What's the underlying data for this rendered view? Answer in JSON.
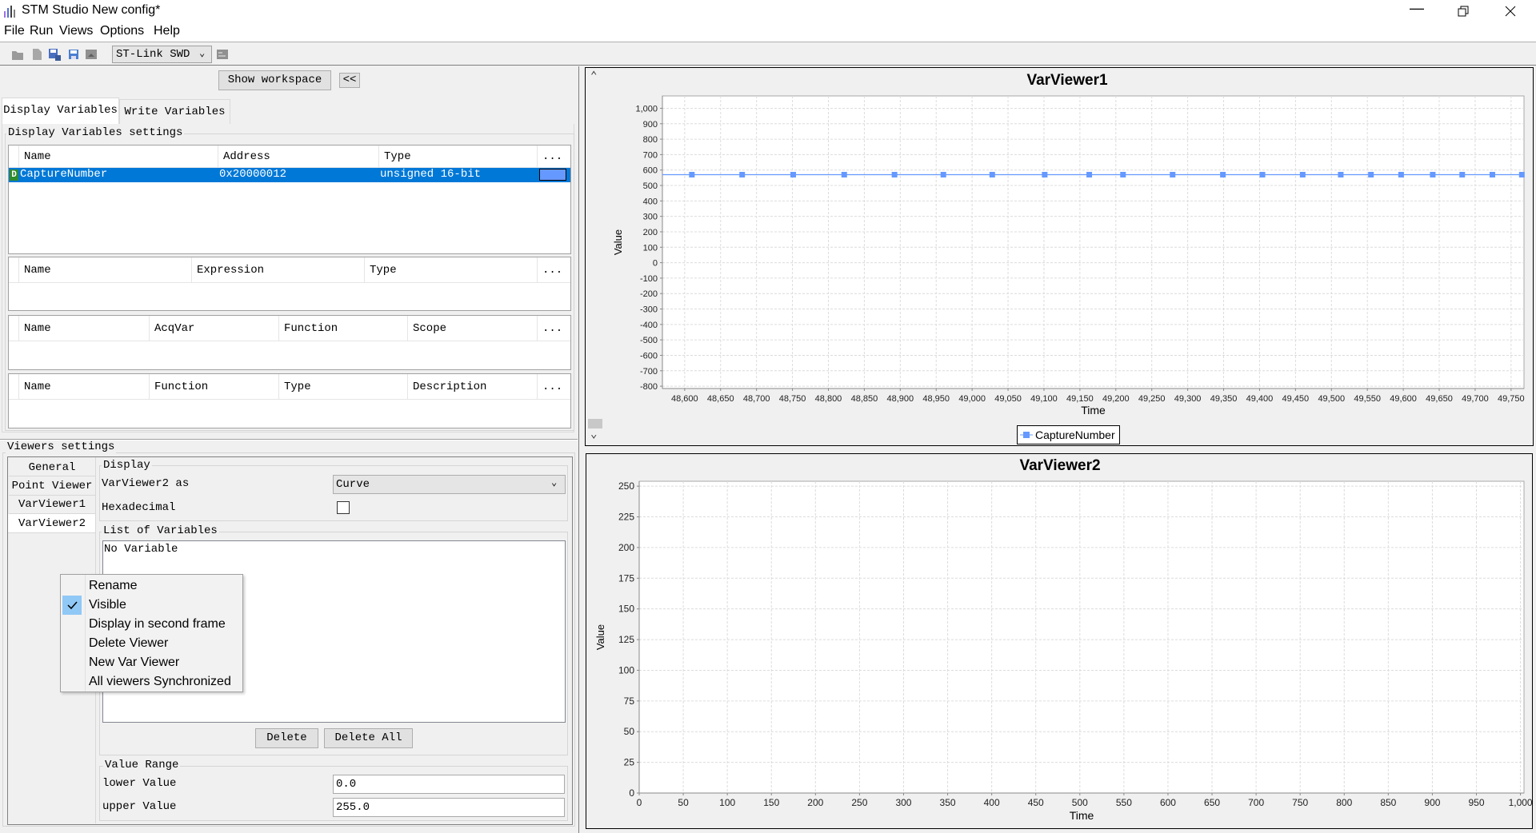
{
  "window": {
    "title": "STM Studio New config*",
    "controls": [
      "minimize",
      "restore",
      "close"
    ]
  },
  "menu": [
    "File",
    "Run",
    "Views",
    "Options",
    "Help"
  ],
  "toolbar": {
    "icons": [
      "open-folder-icon",
      "new-file-icon",
      "save-as-icon",
      "save-icon",
      "export-icon"
    ],
    "probe": "ST-Link SWD",
    "settings_icon": "settings-icon"
  },
  "workspace": {
    "show_label": "Show workspace",
    "collapse_label": "<<"
  },
  "tabs": [
    {
      "label": "Display Variables",
      "active": true
    },
    {
      "label": "Write Variables",
      "active": false
    }
  ],
  "display_settings": {
    "title": "Display Variables settings",
    "var_table": {
      "columns": [
        "Name",
        "Address",
        "Type",
        "..."
      ],
      "rows": [
        {
          "badge": "D",
          "name": "CaptureNumber",
          "address": "0x20000012",
          "type": "unsigned 16-bit",
          "color": "#6699ff",
          "selected": true
        }
      ]
    },
    "expr_table": {
      "columns": [
        "Name",
        "Expression",
        "Type",
        "..."
      ]
    },
    "func_table": {
      "columns": [
        "Name",
        "AcqVar",
        "Function",
        "Scope",
        "..."
      ]
    },
    "desc_table": {
      "columns": [
        "Name",
        "Function",
        "Type",
        "Description",
        "..."
      ]
    }
  },
  "viewers_settings": {
    "title": "Viewers settings",
    "side_tabs": [
      "General",
      "Point Viewer",
      "VarViewer1",
      "VarViewer2"
    ],
    "active_side_tab": "VarViewer2",
    "display": {
      "title": "Display",
      "as_label": "VarViewer2 as",
      "as_value": "Curve",
      "hex_label": "Hexadecimal",
      "hex_checked": false
    },
    "list": {
      "title": "List of Variables",
      "empty": "No Variable",
      "delete": "Delete",
      "delete_all": "Delete All"
    },
    "range": {
      "title": "Value Range",
      "lower_label": "lower Value",
      "lower_value": "0.0",
      "upper_label": "upper Value",
      "upper_value": "255.0"
    }
  },
  "context_menu": {
    "items": [
      {
        "label": "Rename",
        "checked": false
      },
      {
        "label": "Visible",
        "checked": true
      },
      {
        "label": "Display in second frame",
        "checked": false
      },
      {
        "label": "Delete Viewer",
        "checked": false
      },
      {
        "label": "New Var Viewer",
        "checked": false
      },
      {
        "label": "All viewers Synchronized",
        "checked": false
      }
    ]
  },
  "chart_data": [
    {
      "type": "line",
      "title": "VarViewer1",
      "xlabel": "Time",
      "ylabel": "Value",
      "xlim": [
        48569,
        49768
      ],
      "ylim": [
        -815,
        1080
      ],
      "xticks": [
        48600,
        48650,
        48700,
        48750,
        48800,
        48850,
        48900,
        48950,
        49000,
        49050,
        49100,
        49150,
        49200,
        49250,
        49300,
        49350,
        49400,
        49450,
        49500,
        49550,
        49600,
        49650,
        49700,
        49750
      ],
      "yticks": [
        -800,
        -700,
        -600,
        -500,
        -400,
        -300,
        -200,
        -100,
        0,
        100,
        200,
        300,
        400,
        500,
        600,
        700,
        800,
        900,
        1000
      ],
      "grid": true,
      "legend": "bottom-center",
      "color": "#6699ff",
      "series": [
        {
          "name": "CaptureNumber",
          "x": [
            48610,
            48680,
            48751,
            48822,
            48892,
            48960,
            49028,
            49101,
            49163,
            49210,
            49279,
            49349,
            49404,
            49460,
            49513,
            49555,
            49597,
            49641,
            49682,
            49724,
            49765
          ],
          "y": [
            570,
            570,
            570,
            570,
            570,
            570,
            570,
            570,
            570,
            570,
            570,
            570,
            570,
            570,
            570,
            570,
            570,
            570,
            570,
            570,
            570
          ]
        }
      ]
    },
    {
      "type": "line",
      "title": "VarViewer2",
      "xlabel": "Time",
      "ylabel": "Value",
      "xlim": [
        0,
        1004
      ],
      "ylim": [
        0,
        254
      ],
      "xticks": [
        0,
        50,
        100,
        150,
        200,
        250,
        300,
        350,
        400,
        450,
        500,
        550,
        600,
        650,
        700,
        750,
        800,
        850,
        900,
        950,
        1000
      ],
      "yticks": [
        0,
        25,
        50,
        75,
        100,
        125,
        150,
        175,
        200,
        225,
        250
      ],
      "grid": true,
      "series": []
    }
  ]
}
